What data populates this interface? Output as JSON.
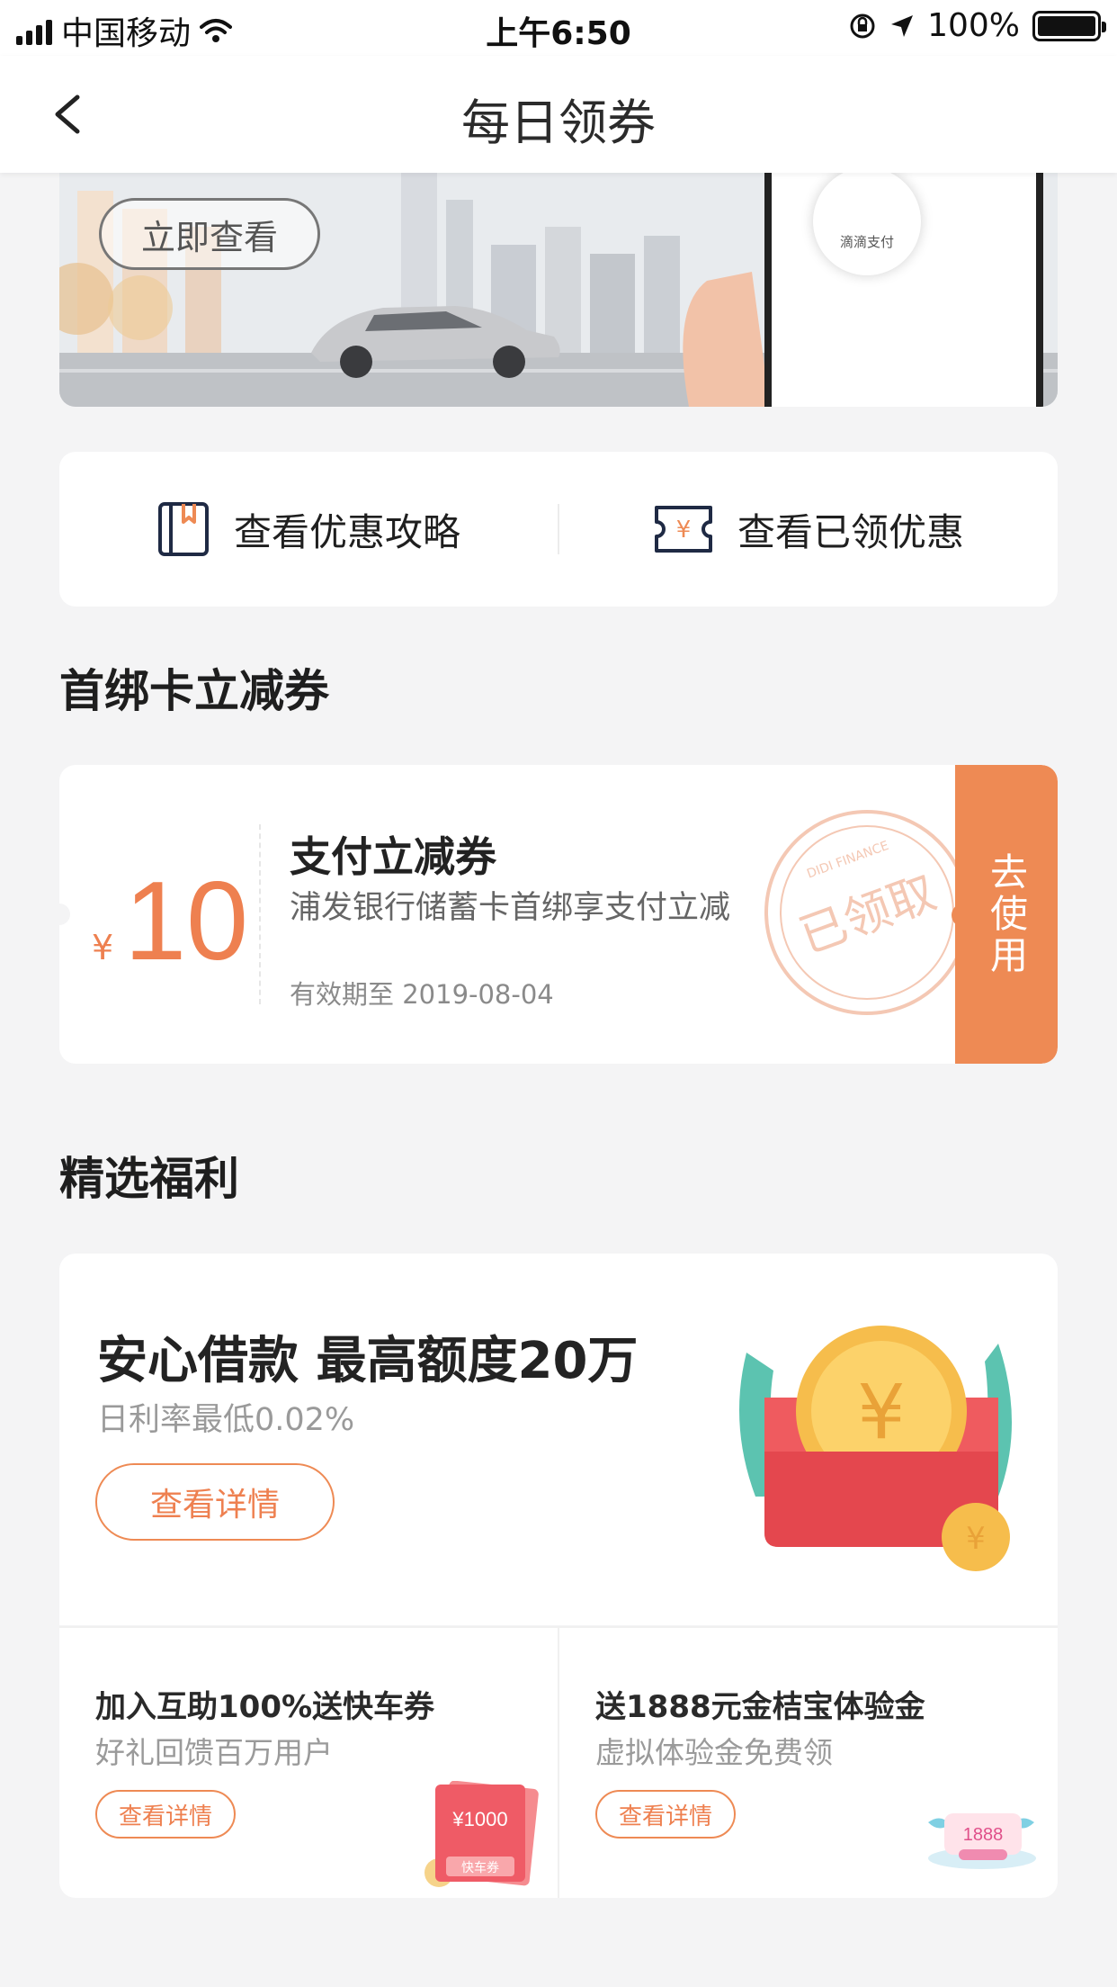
{
  "status_bar": {
    "carrier": "中国移动",
    "time": "上午6:50",
    "battery": "100%"
  },
  "nav": {
    "title": "每日领券"
  },
  "banner": {
    "button_label": "立即查看",
    "phone_text": "滴滴支付"
  },
  "shortcuts": [
    {
      "label": "查看优惠攻略",
      "icon": "book-icon"
    },
    {
      "label": "查看已领优惠",
      "icon": "yen-ticket-icon"
    }
  ],
  "sections": {
    "coupon_title": "首绑卡立减券",
    "benefits_title": "精选福利"
  },
  "coupon": {
    "currency": "¥",
    "amount": "10",
    "title": "支付立减券",
    "description": "浦发银行储蓄卡首绑享支付立减",
    "validity": "有效期至 2019-08-04",
    "stamp_text": "已领取",
    "stamp_brand": "DIDI FINANCE",
    "action_label": "去使用"
  },
  "benefit_main": {
    "title": "安心借款 最高额度20万",
    "subtitle": "日利率最低0.02%",
    "button_label": "查看详情"
  },
  "benefit_items": [
    {
      "title": "加入互助100%送快车券",
      "subtitle": "好礼回馈百万用户",
      "button_label": "查看详情",
      "ticket_value": "¥1000",
      "ticket_label": "快车券"
    },
    {
      "title": "送1888元金桔宝体验金",
      "subtitle": "虚拟体验金免费领",
      "button_label": "查看详情",
      "badge_value": "1888"
    }
  ],
  "colors": {
    "accent": "#ee8a54",
    "accent_text": "#ee8050",
    "background": "#f4f4f5"
  }
}
